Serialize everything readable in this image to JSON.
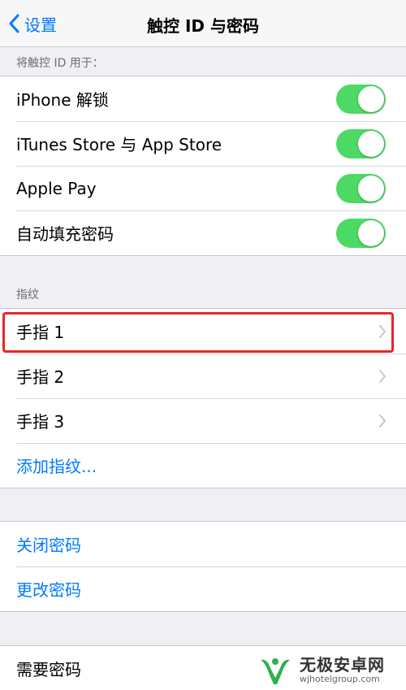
{
  "navbar": {
    "back_label": "设置",
    "title": "触控 ID 与密码"
  },
  "touch_id_section": {
    "header": "将触控 ID 用于：",
    "items": [
      {
        "label": "iPhone 解锁",
        "enabled": true
      },
      {
        "label": "iTunes Store 与 App Store",
        "enabled": true
      },
      {
        "label": "Apple Pay",
        "enabled": true
      },
      {
        "label": "自动填充密码",
        "enabled": true
      }
    ]
  },
  "fingerprints_section": {
    "header": "指纹",
    "items": [
      {
        "label": "手指 1"
      },
      {
        "label": "手指 2"
      },
      {
        "label": "手指 3"
      }
    ],
    "add_label": "添加指纹..."
  },
  "passcode_section": {
    "turn_off_label": "关闭密码",
    "change_label": "更改密码"
  },
  "require_section": {
    "label": "需要密码"
  },
  "watermark": {
    "title": "无极安卓网",
    "url": "wjhotelgroup.com"
  },
  "colors": {
    "accent": "#007aff",
    "switch_on": "#4cd964",
    "highlight": "#e8262a",
    "background": "#efeff4"
  }
}
